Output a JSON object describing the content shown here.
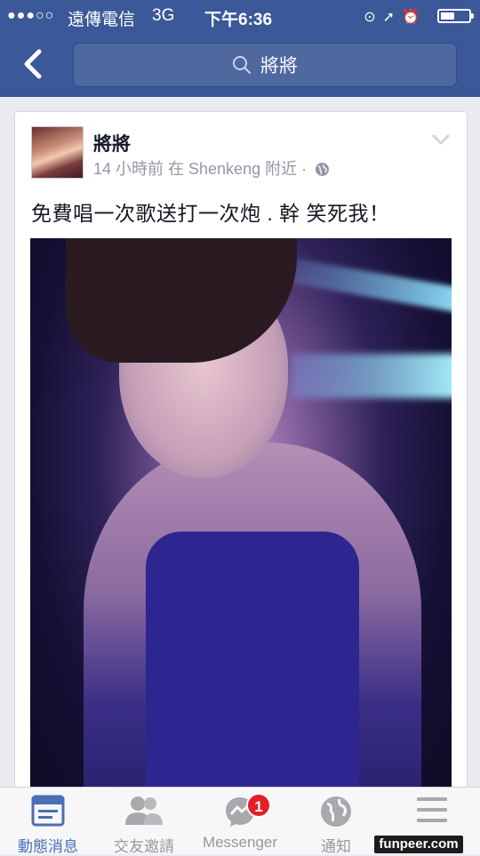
{
  "status_bar": {
    "signal": "●●●○○",
    "carrier": "遠傳電信",
    "network": "3G",
    "time": "下午6:36",
    "battery_level": 0.5
  },
  "nav": {
    "back_icon": "chevron-left-icon",
    "search_query": "將將"
  },
  "post": {
    "author": "將將",
    "meta": "14 小時前 在 Shenkeng 附近 ·",
    "privacy_icon": "globe-icon",
    "text": "免費唱一次歌送打一次炮 . 幹 笑死我！"
  },
  "tabs": [
    {
      "label": "動態消息",
      "icon": "news-feed-icon",
      "active": true
    },
    {
      "label": "交友邀請",
      "icon": "friends-icon"
    },
    {
      "label": "Messenger",
      "icon": "messenger-icon",
      "badge": "1"
    },
    {
      "label": "通知",
      "icon": "globe-icon"
    },
    {
      "label": "",
      "icon": "menu-icon"
    }
  ],
  "watermark": "funpeer.com",
  "colors": {
    "brand": "#3b5998",
    "active_tab": "#4a6fb4",
    "badge": "#e41e26"
  }
}
